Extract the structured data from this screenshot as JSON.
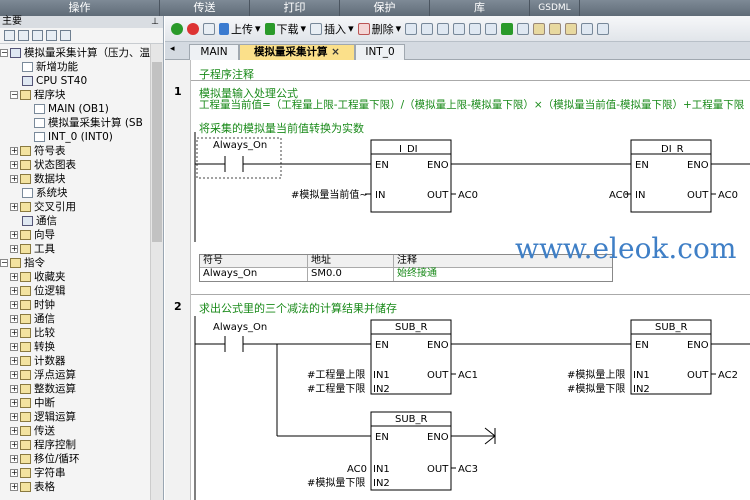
{
  "top_tabs": [
    "操作",
    "传送",
    "打印",
    "保护",
    "库",
    "GSDML"
  ],
  "left_panel": {
    "title": "主要",
    "tree": {
      "root": "模拟量采集计算（压力、温",
      "new_features": "新增功能",
      "cpu": "CPU ST40",
      "program_block": "程序块",
      "main": "MAIN (OB1)",
      "sub": "模拟量采集计算 (SB",
      "int0": "INT_0 (INT0)",
      "symbol_table": "符号表",
      "status_chart": "状态图表",
      "data_block": "数据块",
      "system_block": "系统块",
      "cross_ref": "交叉引用",
      "comm": "通信",
      "wizard": "向导",
      "tools": "工具",
      "instructions": "指令",
      "favorites": "收藏夹",
      "bit_logic": "位逻辑",
      "clock": "时钟",
      "comm2": "通信",
      "compare": "比较",
      "convert": "转换",
      "counter": "计数器",
      "float_math": "浮点运算",
      "int_math": "整数运算",
      "interrupt": "中断",
      "logic_ops": "逻辑运算",
      "transfer": "传送",
      "program_ctrl": "程序控制",
      "shift_rotate": "移位/循环",
      "string": "字符串",
      "table": "表格"
    }
  },
  "toolbar": {
    "upload": "上传",
    "download": "下载",
    "insert": "插入",
    "delete": "删除"
  },
  "editor_tabs": {
    "main": "MAIN",
    "sub": "模拟量采集计算",
    "close": "×",
    "int0": "INT_0"
  },
  "editor": {
    "sub_comment": "子程序注释",
    "net1": {
      "number": "1",
      "title": "模拟量输入处理公式",
      "formula": "工程量当前值=（工程量上限-工程量下限）/（模拟量上限-模拟量下限）×（模拟量当前值-模拟量下限）+工程量下限",
      "comment": "将采集的模拟量当前值转换为实数",
      "contact": "Always_On",
      "idi": {
        "name": "I_DI",
        "en": "EN",
        "eno": "ENO",
        "in": "IN",
        "out": "OUT",
        "in_val": "#模拟量当前值~",
        "out_val": "AC0"
      },
      "dir": {
        "name": "DI_R",
        "en": "EN",
        "eno": "ENO",
        "in": "IN",
        "out": "OUT",
        "in_val": "AC0",
        "out_val": "AC0"
      },
      "symtable": {
        "headers": [
          "符号",
          "地址",
          "注释"
        ],
        "row": [
          "Always_On",
          "SM0.0",
          "始终接通"
        ]
      }
    },
    "net2": {
      "number": "2",
      "title": "求出公式里的三个减法的计算结果并储存",
      "contact": "Always_On",
      "sub1": {
        "name": "SUB_R",
        "en": "EN",
        "eno": "ENO",
        "in1": "IN1",
        "in2": "IN2",
        "out": "OUT",
        "in1_val": "#工程量上限",
        "in2_val": "#工程量下限",
        "out_val": "AC1"
      },
      "sub2": {
        "name": "SUB_R",
        "en": "EN",
        "eno": "ENO",
        "in1": "IN1",
        "in2": "IN2",
        "out": "OUT",
        "in1_val": "#模拟量上限",
        "in2_val": "#模拟量下限",
        "out_val": "AC2"
      },
      "sub3": {
        "name": "SUB_R",
        "en": "EN",
        "eno": "ENO",
        "in1": "IN1",
        "in2": "IN2",
        "out": "OUT",
        "in1_val": "AC0",
        "in2_val": "#模拟量下限",
        "out_val": "AC3"
      }
    }
  },
  "watermark": "www.eleok.com"
}
